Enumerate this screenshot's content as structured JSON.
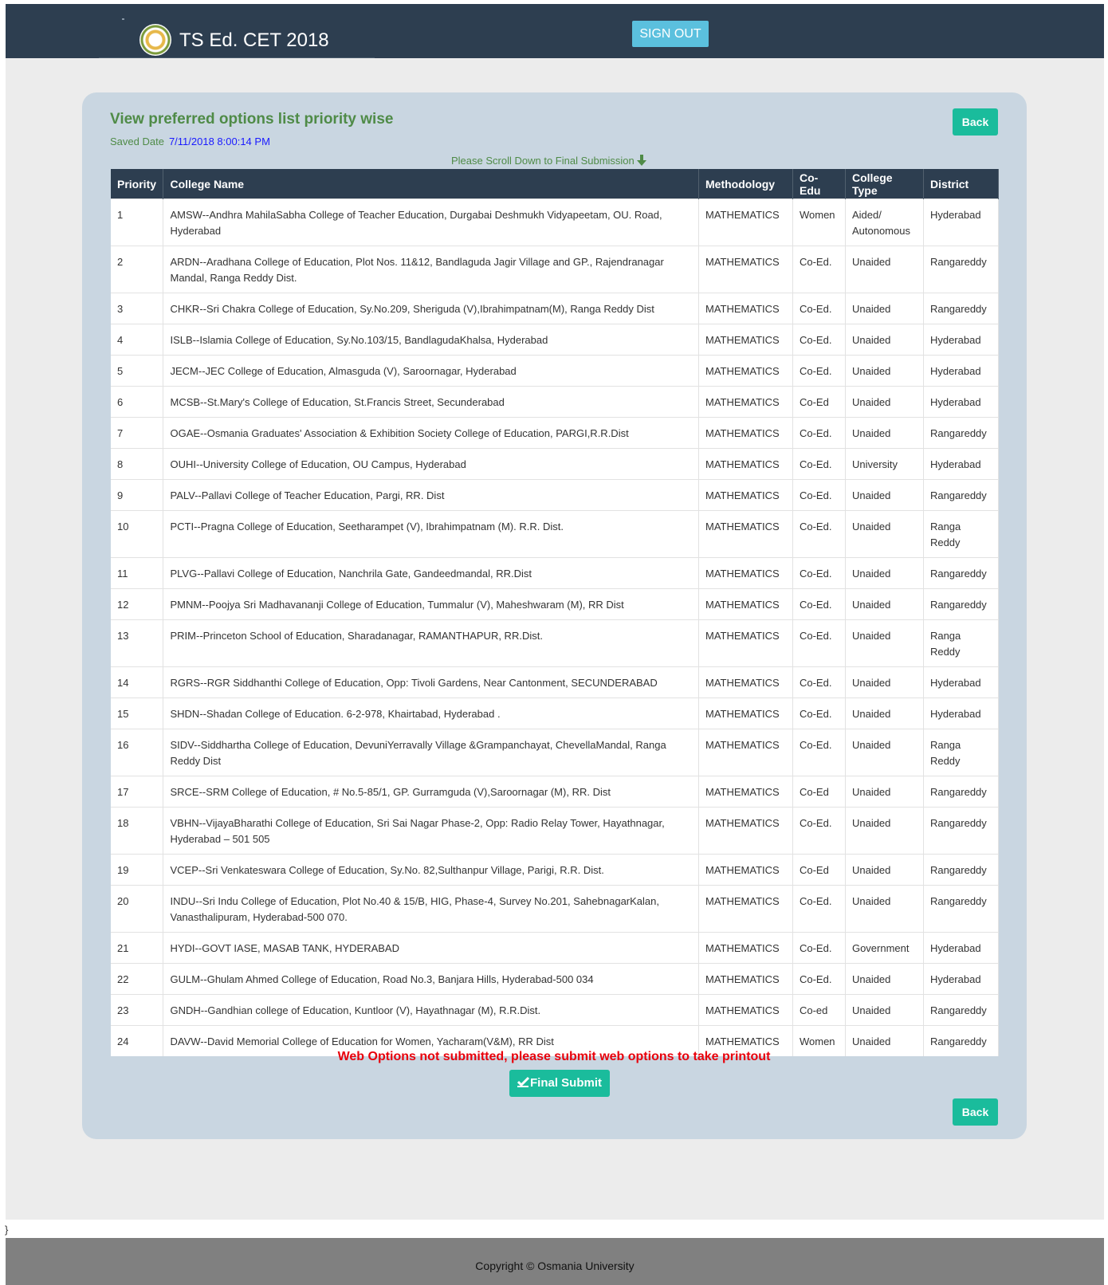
{
  "header": {
    "title": "TS Ed. CET 2018",
    "signout_label": "SIGN OUT"
  },
  "main": {
    "title": "View preferred options list priority wise",
    "saved_label": "Saved Date",
    "saved_value": "7/11/2018 8:00:14 PM",
    "back_label": "Back",
    "scroll_hint": "Please Scroll Down to Final Submission",
    "warning": "Web Options not submitted, please submit web options to take printout",
    "final_submit_label": "Final Submit"
  },
  "table": {
    "columns": [
      "Priority",
      "College Name",
      "Methodology",
      "Co-Edu",
      "College Type",
      "District"
    ],
    "rows": [
      [
        "1",
        "AMSW--Andhra MahilaSabha College of Teacher Education, Durgabai Deshmukh Vidyapeetam, OU. Road, Hyderabad",
        "MATHEMATICS",
        "Women",
        "Aided/ Autonomous",
        "Hyderabad"
      ],
      [
        "2",
        "ARDN--Aradhana College of Education, Plot Nos. 11&12, Bandlaguda Jagir Village and GP., Rajendranagar Mandal, Ranga Reddy Dist.",
        "MATHEMATICS",
        "Co-Ed.",
        "Unaided",
        "Rangareddy"
      ],
      [
        "3",
        "CHKR--Sri Chakra College of Education, Sy.No.209, Sheriguda (V),Ibrahimpatnam(M), Ranga Reddy Dist",
        "MATHEMATICS",
        "Co-Ed.",
        "Unaided",
        "Rangareddy"
      ],
      [
        "4",
        "ISLB--Islamia College of Education, Sy.No.103/15, BandlagudaKhalsa, Hyderabad",
        "MATHEMATICS",
        "Co-Ed.",
        "Unaided",
        "Hyderabad"
      ],
      [
        "5",
        "JECM--JEC College of Education, Almasguda (V), Saroornagar, Hyderabad",
        "MATHEMATICS",
        "Co-Ed.",
        "Unaided",
        "Hyderabad"
      ],
      [
        "6",
        "MCSB--St.Mary's College of Education, St.Francis Street, Secunderabad",
        "MATHEMATICS",
        "Co-Ed",
        "Unaided",
        "Hyderabad"
      ],
      [
        "7",
        "OGAE--Osmania Graduates' Association & Exhibition Society College of Education, PARGI,R.R.Dist",
        "MATHEMATICS",
        "Co-Ed.",
        "Unaided",
        "Rangareddy"
      ],
      [
        "8",
        "OUHI--University College of Education, OU Campus, Hyderabad",
        "MATHEMATICS",
        "Co-Ed.",
        "University",
        "Hyderabad"
      ],
      [
        "9",
        "PALV--Pallavi College of Teacher Education, Pargi, RR. Dist",
        "MATHEMATICS",
        "Co-Ed.",
        "Unaided",
        "Rangareddy"
      ],
      [
        "10",
        "PCTI--Pragna College of Education, Seetharampet (V), Ibrahimpatnam (M). R.R. Dist.",
        "MATHEMATICS",
        "Co-Ed.",
        "Unaided",
        "Ranga Reddy"
      ],
      [
        "11",
        "PLVG--Pallavi College of Education, Nanchrila Gate, Gandeedmandal, RR.Dist",
        "MATHEMATICS",
        "Co-Ed.",
        "Unaided",
        "Rangareddy"
      ],
      [
        "12",
        "PMNM--Poojya Sri Madhavananji College of Education, Tummalur (V), Maheshwaram (M), RR Dist",
        "MATHEMATICS",
        "Co-Ed.",
        "Unaided",
        "Rangareddy"
      ],
      [
        "13",
        "PRIM--Princeton School of Education, Sharadanagar, RAMANTHAPUR, RR.Dist.",
        "MATHEMATICS",
        "Co-Ed.",
        "Unaided",
        "Ranga Reddy"
      ],
      [
        "14",
        "RGRS--RGR Siddhanthi College of Education, Opp: Tivoli Gardens, Near Cantonment, SECUNDERABAD",
        "MATHEMATICS",
        "Co-Ed.",
        "Unaided",
        "Hyderabad"
      ],
      [
        "15",
        "SHDN--Shadan College of Education. 6-2-978, Khairtabad, Hyderabad .",
        "MATHEMATICS",
        "Co-Ed.",
        "Unaided",
        "Hyderabad"
      ],
      [
        "16",
        "SIDV--Siddhartha College of Education, DevuniYerravally Village &Grampanchayat, ChevellaMandal, Ranga Reddy Dist",
        "MATHEMATICS",
        "Co-Ed.",
        "Unaided",
        "Ranga Reddy"
      ],
      [
        "17",
        "SRCE--SRM College of Education, # No.5-85/1, GP. Gurramguda (V),Saroornagar (M), RR. Dist",
        "MATHEMATICS",
        "Co-Ed",
        "Unaided",
        "Rangareddy"
      ],
      [
        "18",
        "VBHN--VijayaBharathi College of Education, Sri Sai Nagar Phase-2, Opp: Radio Relay Tower, Hayathnagar, Hyderabad – 501 505",
        "MATHEMATICS",
        "Co-Ed.",
        "Unaided",
        "Rangareddy"
      ],
      [
        "19",
        "VCEP--Sri Venkateswara College of Education, Sy.No. 82,Sulthanpur Village, Parigi, R.R. Dist.",
        "MATHEMATICS",
        "Co-Ed",
        "Unaided",
        "Rangareddy"
      ],
      [
        "20",
        "INDU--Sri Indu College of Education, Plot No.40 & 15/B, HIG, Phase-4, Survey No.201, SahebnagarKalan, Vanasthalipuram, Hyderabad-500 070.",
        "MATHEMATICS",
        "Co-Ed.",
        "Unaided",
        "Rangareddy"
      ],
      [
        "21",
        "HYDI--GOVT IASE, MASAB TANK, HYDERABAD",
        "MATHEMATICS",
        "Co-Ed.",
        "Government",
        "Hyderabad"
      ],
      [
        "22",
        "GULM--Ghulam Ahmed College of Education, Road No.3, Banjara Hills, Hyderabad-500 034",
        "MATHEMATICS",
        "Co-Ed.",
        "Unaided",
        "Hyderabad"
      ],
      [
        "23",
        "GNDH--Gandhian college of Education, Kuntloor (V), Hayathnagar (M), R.R.Dist.",
        "MATHEMATICS",
        "Co-ed",
        "Unaided",
        "Rangareddy"
      ],
      [
        "24",
        "DAVW--David Memorial College of Education for Women, Yacharam(V&M), RR Dist",
        "MATHEMATICS",
        "Women",
        "Unaided",
        "Rangareddy"
      ]
    ]
  },
  "footer": {
    "copyright": "Copyright © Osmania University"
  },
  "stray_text": "}"
}
